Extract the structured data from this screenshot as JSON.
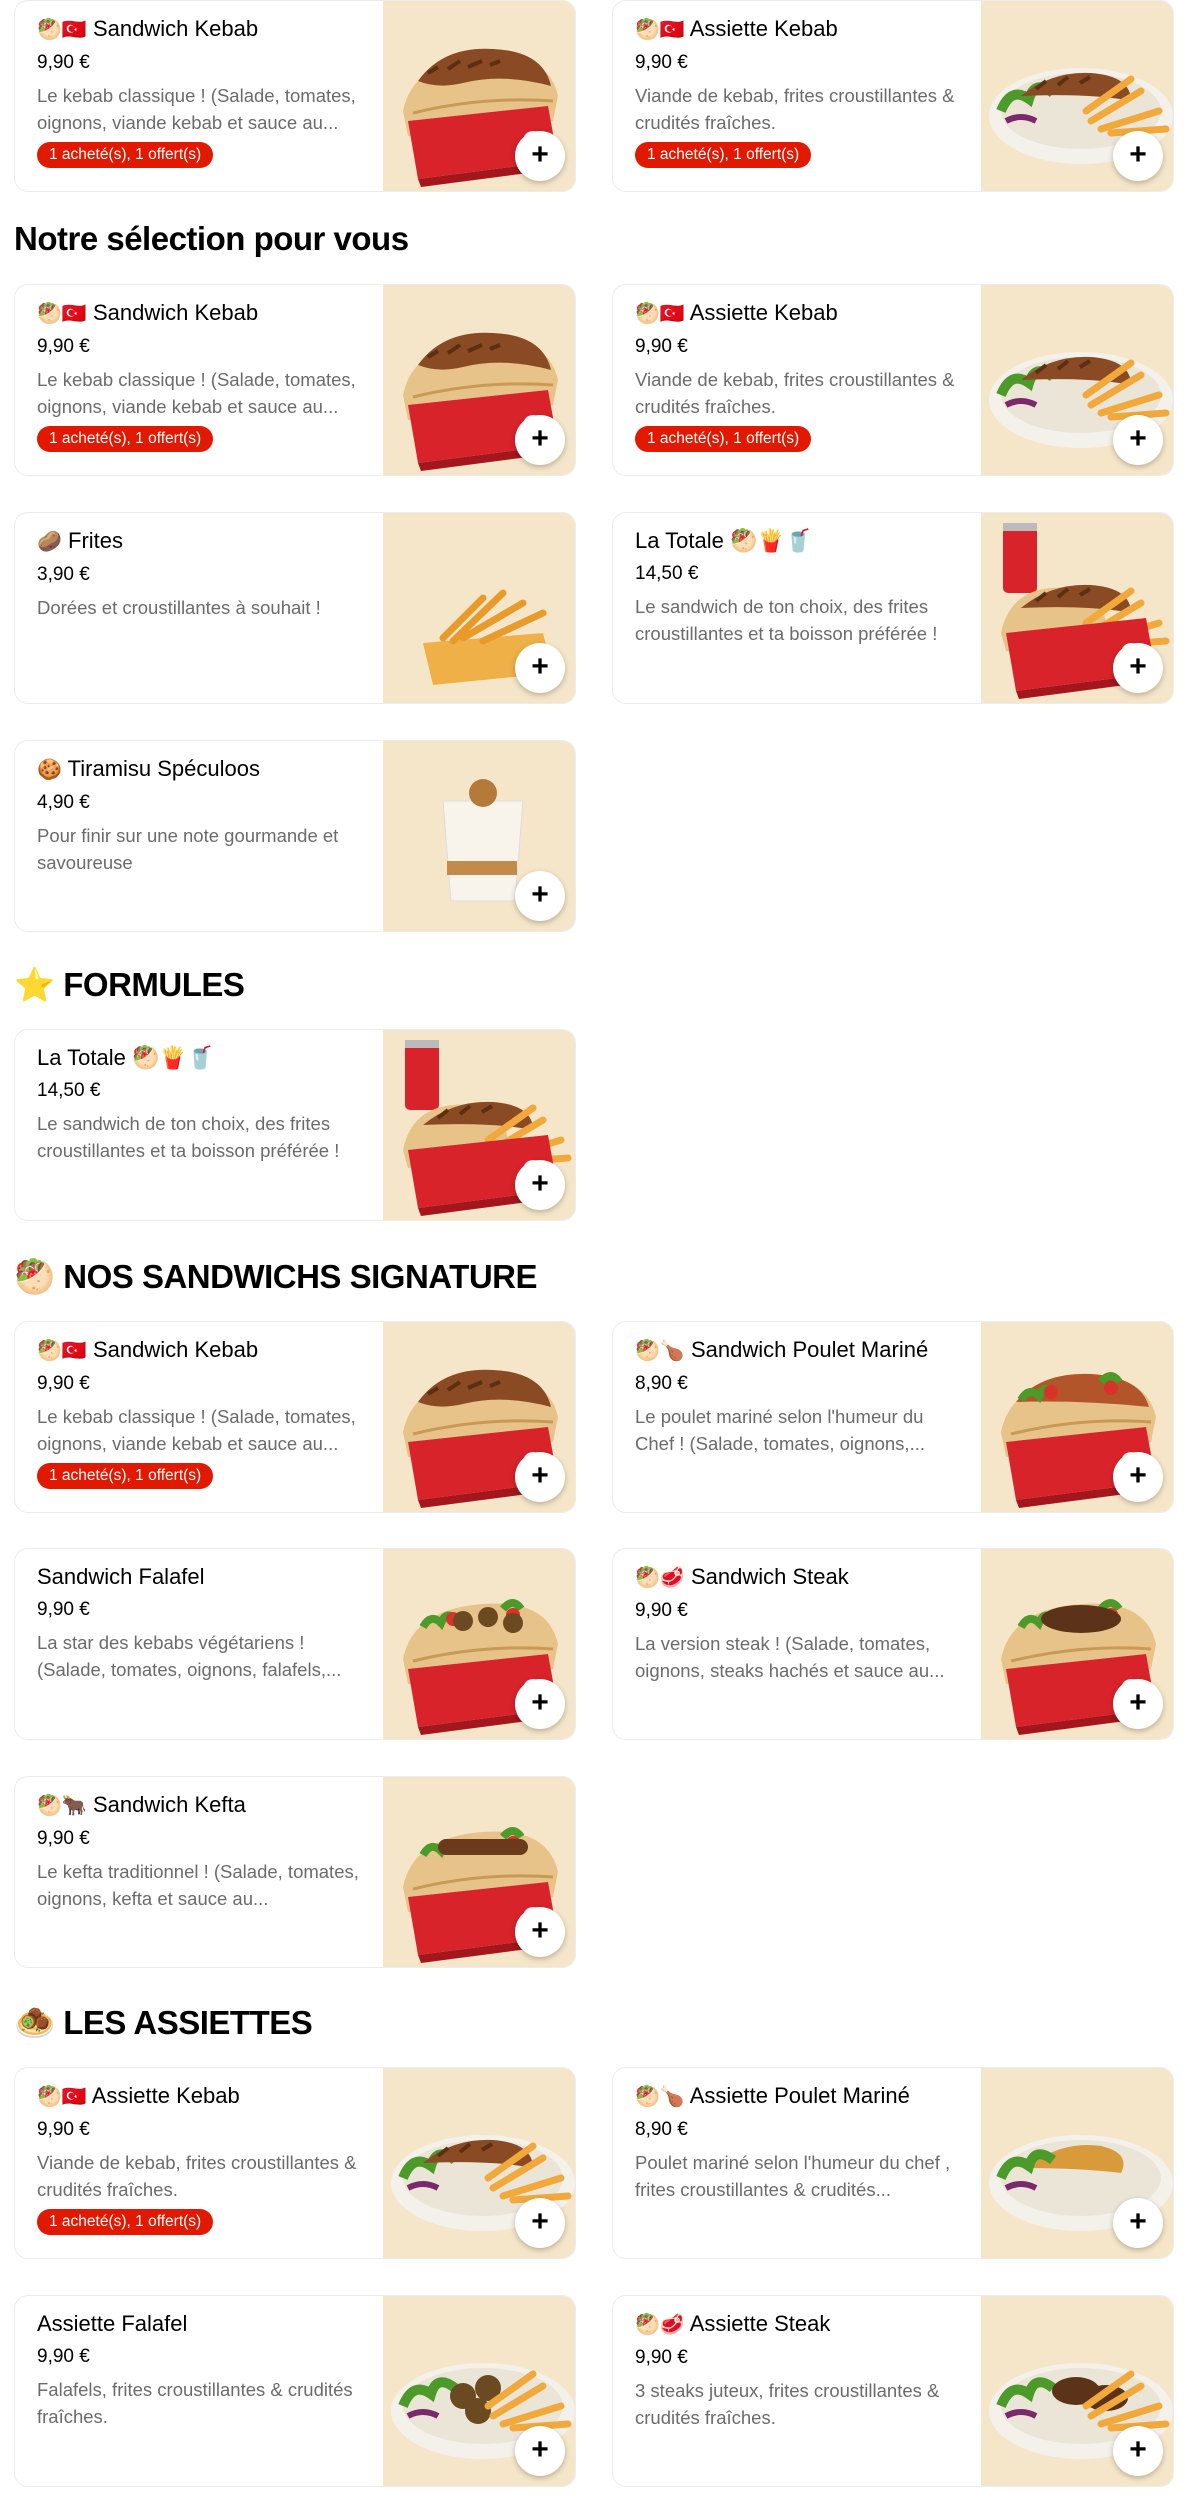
{
  "plus_symbol": "+",
  "promo_text": "1 acheté(s), 1 offert(s)",
  "colors": {
    "promo_red": "#e11900",
    "image_bg": "#f6e6c9"
  },
  "top_row": [
    {
      "emoji": "🥙🇹🇷",
      "title": "Sandwich Kebab",
      "price": "9,90 €",
      "desc": "Le kebab classique ! (Salade, tomates, oignons, viande kebab et sauce au...",
      "promo": true,
      "image": "sandwich-kebab"
    },
    {
      "emoji": "🥙🇹🇷",
      "title": "Assiette Kebab",
      "price": "9,90 €",
      "desc": "Viande de kebab, frites croustillantes & crudités fraîches.",
      "promo": true,
      "image": "assiette-kebab"
    }
  ],
  "sections": {
    "selection": {
      "title": "Notre sélection pour vous"
    },
    "formules": {
      "emoji": "⭐",
      "title": "FORMULES"
    },
    "sandwichs": {
      "emoji": "🥙",
      "title": "NOS SANDWICHS SIGNATURE"
    },
    "assiettes": {
      "emoji": "🧆",
      "title": "LES ASSIETTES"
    }
  },
  "selection_items": [
    {
      "emoji": "🥙🇹🇷",
      "title": "Sandwich Kebab",
      "price": "9,90 €",
      "desc": "Le kebab classique ! (Salade, tomates, oignons, viande kebab et sauce au...",
      "promo": true,
      "image": "sandwich-kebab"
    },
    {
      "emoji": "🥙🇹🇷",
      "title": "Assiette Kebab",
      "price": "9,90 €",
      "desc": "Viande de kebab, frites croustillantes & crudités fraîches.",
      "promo": true,
      "image": "assiette-kebab"
    },
    {
      "emoji": "🥔",
      "title": "Frites",
      "price": "3,90 €",
      "desc": "Dorées et croustillantes à souhait !",
      "promo": false,
      "image": "frites"
    },
    {
      "emoji": "",
      "title": "La Totale 🥙🍟🥤",
      "price": "14,50 €",
      "desc": "Le sandwich de ton choix, des frites croustillantes et ta boisson préférée !",
      "promo": false,
      "image": "la-totale"
    },
    {
      "emoji": "🍪",
      "title": "Tiramisu Spéculoos",
      "price": "4,90 €",
      "desc": "Pour finir sur une note gourmande et savoureuse",
      "promo": false,
      "image": "tiramisu"
    }
  ],
  "formules_items": [
    {
      "emoji": "",
      "title": "La Totale 🥙🍟🥤",
      "price": "14,50 €",
      "desc": "Le sandwich de ton choix, des frites croustillantes et ta boisson préférée !",
      "promo": false,
      "image": "la-totale"
    }
  ],
  "sandwich_items": [
    {
      "emoji": "🥙🇹🇷",
      "title": "Sandwich Kebab",
      "price": "9,90 €",
      "desc": "Le kebab classique ! (Salade, tomates, oignons, viande kebab et sauce au...",
      "promo": true,
      "image": "sandwich-kebab"
    },
    {
      "emoji": "🥙🍗",
      "title": "Sandwich Poulet Mariné",
      "price": "8,90 €",
      "desc": "Le poulet mariné selon l'humeur du Chef ! (Salade, tomates, oignons,...",
      "promo": false,
      "image": "sandwich-poulet"
    },
    {
      "emoji": "",
      "title": "Sandwich Falafel",
      "price": "9,90 €",
      "desc": "La star des kebabs végétariens ! (Salade, tomates, oignons, falafels,...",
      "promo": false,
      "image": "sandwich-falafel"
    },
    {
      "emoji": "🥙🥩",
      "title": "Sandwich Steak",
      "price": "9,90 €",
      "desc": "La version steak ! (Salade, tomates, oignons, steaks hachés et sauce au...",
      "promo": false,
      "image": "sandwich-steak"
    },
    {
      "emoji": "🥙🐂",
      "title": "Sandwich Kefta",
      "price": "9,90 €",
      "desc": "Le kefta traditionnel ! (Salade, tomates, oignons, kefta et sauce au...",
      "promo": false,
      "image": "sandwich-kefta"
    }
  ],
  "assiette_items": [
    {
      "emoji": "🥙🇹🇷",
      "title": "Assiette Kebab",
      "price": "9,90 €",
      "desc": "Viande de kebab, frites croustillantes & crudités fraîches.",
      "promo": true,
      "image": "assiette-kebab"
    },
    {
      "emoji": "🥙🍗",
      "title": "Assiette Poulet Mariné",
      "price": "8,90 €",
      "desc": "Poulet mariné selon l'humeur du chef , frites croustillantes & crudités...",
      "promo": false,
      "image": "assiette-poulet"
    },
    {
      "emoji": "",
      "title": "Assiette Falafel",
      "price": "9,90 €",
      "desc": "Falafels, frites croustillantes & crudités fraîches.",
      "promo": false,
      "image": "assiette-falafel"
    },
    {
      "emoji": "🥙🥩",
      "title": "Assiette Steak",
      "price": "9,90 €",
      "desc": "3 steaks juteux, frites croustillantes & crudités fraîches.",
      "promo": false,
      "image": "assiette-steak"
    }
  ]
}
